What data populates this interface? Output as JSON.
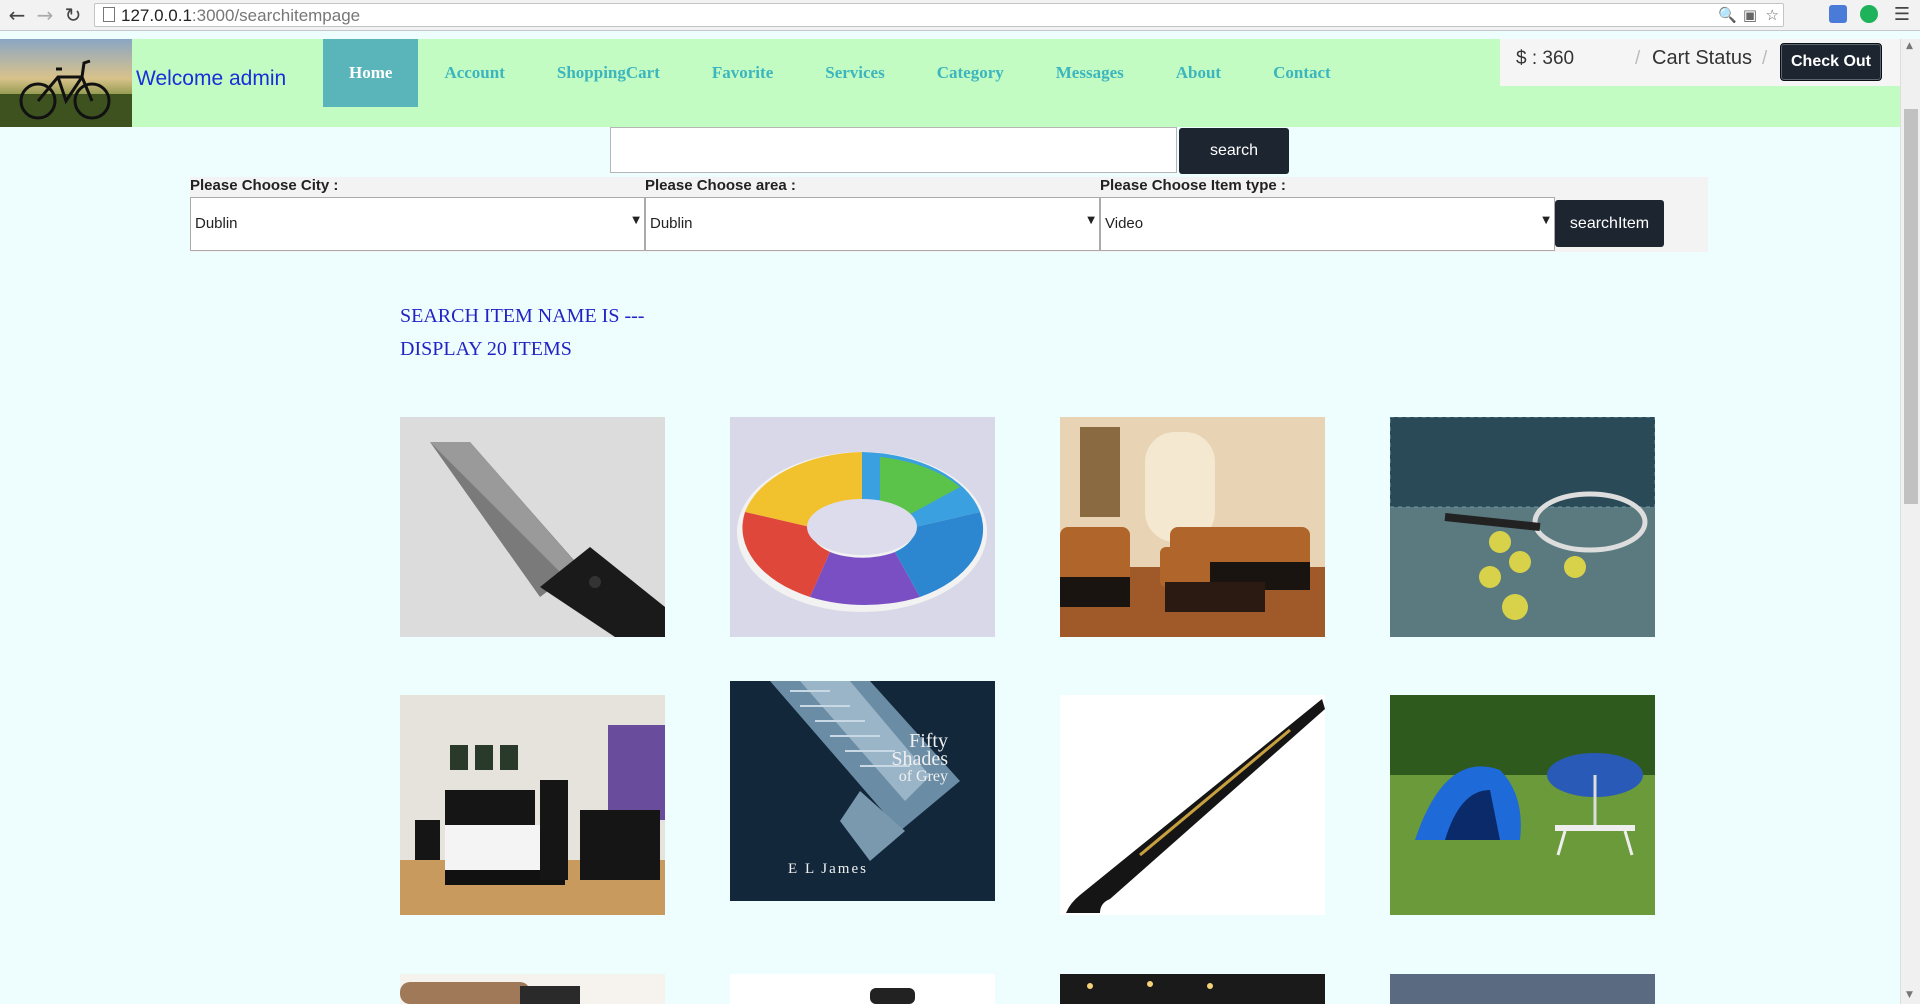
{
  "browser": {
    "url_host": "127.0.0.1",
    "url_path": ":3000/searchitempage"
  },
  "header": {
    "welcome": "Welcome admin",
    "nav": [
      {
        "label": "Home",
        "active": true
      },
      {
        "label": "Account"
      },
      {
        "label": "ShoppingCart"
      },
      {
        "label": "Favorite"
      },
      {
        "label": "Services"
      },
      {
        "label": "Category"
      },
      {
        "label": "Messages"
      },
      {
        "label": "About"
      },
      {
        "label": "Contact"
      }
    ],
    "price": "$ : 360",
    "separator": "/",
    "cart_status": "Cart Status",
    "checkout_label": "Check Out"
  },
  "search": {
    "value": "",
    "button_label": "search"
  },
  "filters": {
    "city_label": "Please Choose City :",
    "city_value": "Dublin",
    "area_label": "Please Choose area :",
    "area_value": "Dublin",
    "type_label": "Please Choose Item type :",
    "type_value": "Video",
    "button_label": "searchItem"
  },
  "results": {
    "search_name": "SEARCH ITEM NAME IS ---",
    "display_count": "DISPLAY 20 ITEMS"
  },
  "items": [
    {
      "icon": "knife-image"
    },
    {
      "icon": "swim-ring-image"
    },
    {
      "icon": "living-room-sofa-image"
    },
    {
      "icon": "tennis-racket-image"
    },
    {
      "icon": "bedroom-image"
    },
    {
      "icon": "fifty-shades-book-image",
      "text_title": "Fifty Shades of Grey",
      "text_author": "E L James"
    },
    {
      "icon": "hockey-stick-image"
    },
    {
      "icon": "tent-camping-image"
    }
  ],
  "colors": {
    "header_bg": "#c2fcc2",
    "page_bg": "#eefefe",
    "nav_active_bg": "#5ab5ba",
    "nav_text": "#3cb5be",
    "button_dark": "#1d2530",
    "info_text": "#2323c4"
  }
}
